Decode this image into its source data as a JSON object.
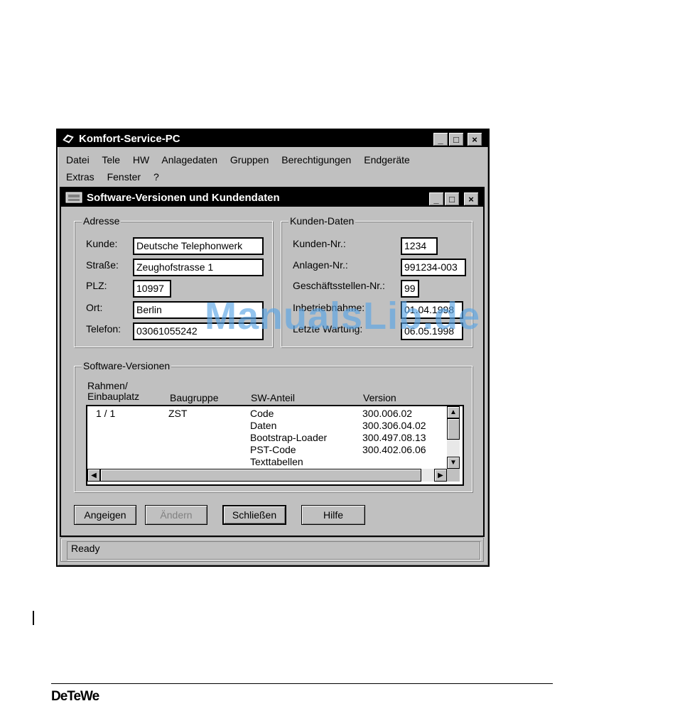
{
  "app": {
    "title": "Komfort-Service-PC"
  },
  "menu": [
    "Datei",
    "Tele",
    "HW",
    "Anlagedaten",
    "Gruppen",
    "Berechtigungen",
    "Endgeräte",
    "Extras",
    "Fenster",
    "?"
  ],
  "dialog": {
    "title": "Software-Versionen und Kundendaten",
    "adresse": {
      "legend": "Adresse",
      "kunde_label": "Kunde:",
      "kunde": "Deutsche Telephonwerk",
      "strasse_label": "Straße:",
      "strasse": "Zeughofstrasse 1",
      "plz_label": "PLZ:",
      "plz": "10997",
      "ort_label": "Ort:",
      "ort": "Berlin",
      "telefon_label": "Telefon:",
      "telefon": "03061055242"
    },
    "kunden": {
      "legend": "Kunden-Daten",
      "kundennr_label": "Kunden-Nr.:",
      "kundennr": "1234",
      "anlagennr_label": "Anlagen-Nr.:",
      "anlagennr": "991234-003",
      "gst_label": "Geschäftsstellen-Nr.:",
      "gst": "99",
      "inbetrieb_label": "Inbetriebnahme:",
      "inbetrieb": "01.04.1998",
      "wartung_label": "Letzte Wartung:",
      "wartung": "06.05.1998"
    },
    "sw": {
      "legend": "Software-Versionen",
      "col_rahmen_1": "Rahmen/",
      "col_rahmen_2": "Einbauplatz",
      "col_baugruppe": "Baugruppe",
      "col_anteil": "SW-Anteil",
      "col_version": "Version",
      "rahmen": "1  /  1",
      "baugruppe": "ZST",
      "rows": [
        {
          "anteil": "Code",
          "version": "300.006.02"
        },
        {
          "anteil": "Daten",
          "version": "300.306.04.02"
        },
        {
          "anteil": "Bootstrap-Loader",
          "version": "300.497.08.13"
        },
        {
          "anteil": "PST-Code",
          "version": "300.402.06.06"
        },
        {
          "anteil": "Texttabellen",
          "version": ""
        }
      ]
    },
    "buttons": {
      "anzeigen": "Angeigen",
      "aendern": "Ändern",
      "schliessen": "Schließen",
      "hilfe": "Hilfe"
    }
  },
  "status": "Ready",
  "watermark": "ManualsLib.de",
  "footer_logo": "DeTeWe",
  "colors": {
    "titlebar": "#000000",
    "face": "#c0c0c0",
    "watermark": "#5aa5e6"
  }
}
